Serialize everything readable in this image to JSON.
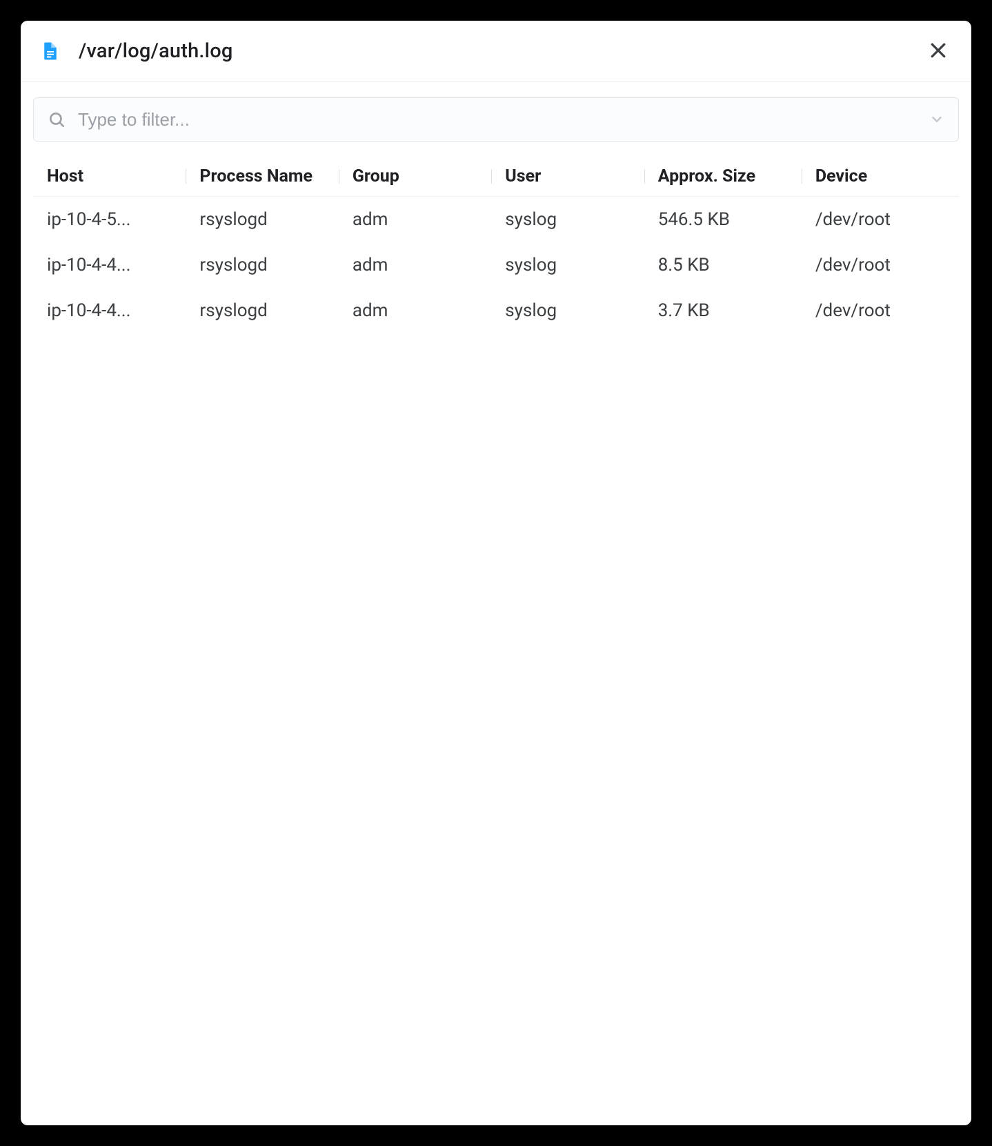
{
  "header": {
    "title": "/var/log/auth.log"
  },
  "filter": {
    "placeholder": "Type to filter...",
    "value": ""
  },
  "table": {
    "columns": {
      "host": "Host",
      "process": "Process Name",
      "group": "Group",
      "user": "User",
      "size": "Approx. Size",
      "device": "Device"
    },
    "rows": [
      {
        "host": "ip-10-4-5...",
        "process": "rsyslogd",
        "group": "adm",
        "user": "syslog",
        "size": "546.5 KB",
        "device": "/dev/root"
      },
      {
        "host": "ip-10-4-4...",
        "process": "rsyslogd",
        "group": "adm",
        "user": "syslog",
        "size": "8.5 KB",
        "device": "/dev/root"
      },
      {
        "host": "ip-10-4-4...",
        "process": "rsyslogd",
        "group": "adm",
        "user": "syslog",
        "size": "3.7 KB",
        "device": "/dev/root"
      }
    ]
  }
}
